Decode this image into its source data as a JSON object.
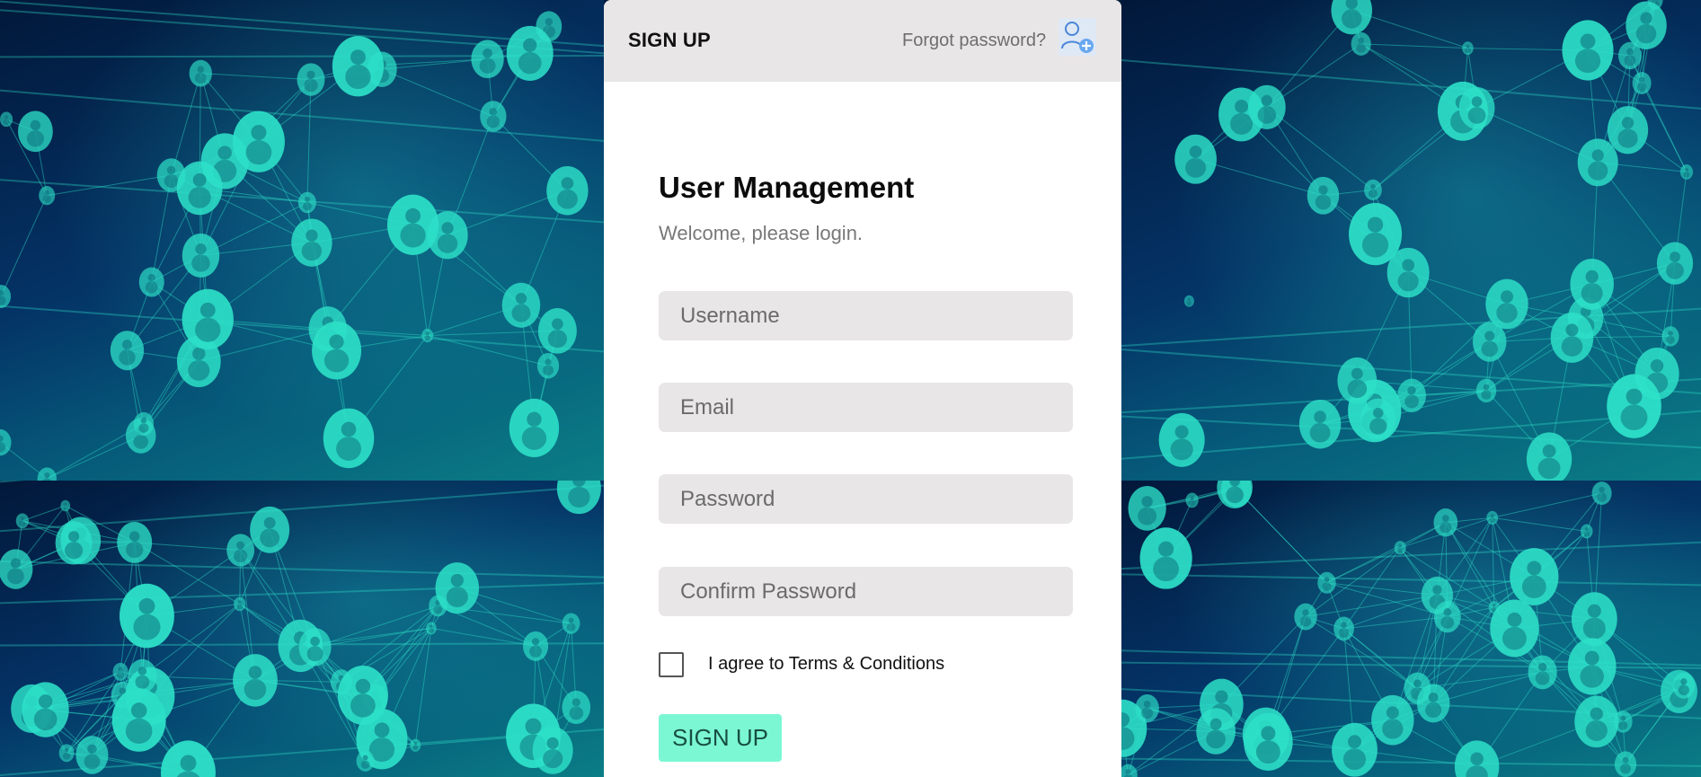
{
  "header": {
    "title": "SIGN UP",
    "forgot_password": "Forgot password?",
    "add_user_icon": "add-user-icon"
  },
  "form": {
    "title": "User Management",
    "subtitle": "Welcome, please login.",
    "username_placeholder": "Username",
    "email_placeholder": "Email",
    "password_placeholder": "Password",
    "confirm_password_placeholder": "Confirm Password",
    "terms_label": "I agree to Terms & Conditions",
    "terms_checked": false,
    "submit_label": "SIGN UP"
  },
  "colors": {
    "accent_button": "#7cf7d4",
    "header_bg": "#e8e6e6",
    "field_bg": "#e8e6e6",
    "background_network": "#2de0c8"
  }
}
